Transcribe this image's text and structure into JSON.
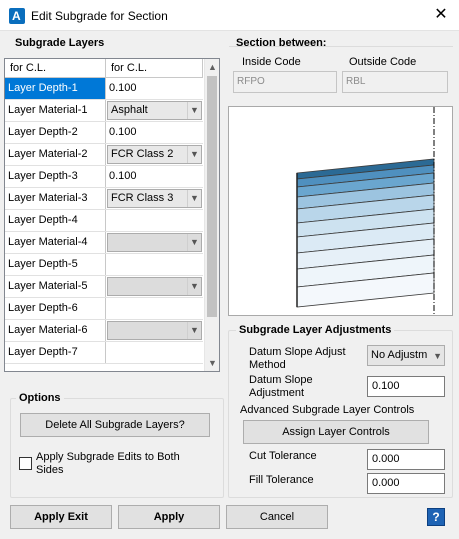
{
  "window": {
    "title": "Edit Subgrade for Section",
    "app_icon_letter": "A"
  },
  "subgrade_layers": {
    "group_label": "Subgrade Layers",
    "columns": [
      "for C.L.",
      "for C.L."
    ],
    "rows": [
      {
        "label": "Layer Depth-1",
        "type": "text",
        "value": "0.100",
        "selected": true
      },
      {
        "label": "Layer Material-1",
        "type": "combo",
        "value": "Asphalt"
      },
      {
        "label": "Layer Depth-2",
        "type": "text",
        "value": "0.100"
      },
      {
        "label": "Layer Material-2",
        "type": "combo",
        "value": "FCR Class 2"
      },
      {
        "label": "Layer Depth-3",
        "type": "text",
        "value": "0.100"
      },
      {
        "label": "Layer Material-3",
        "type": "combo",
        "value": "FCR Class 3"
      },
      {
        "label": "Layer Depth-4",
        "type": "text",
        "value": ""
      },
      {
        "label": "Layer Material-4",
        "type": "combo",
        "value": ""
      },
      {
        "label": "Layer Depth-5",
        "type": "text",
        "value": ""
      },
      {
        "label": "Layer Material-5",
        "type": "combo",
        "value": ""
      },
      {
        "label": "Layer Depth-6",
        "type": "text",
        "value": ""
      },
      {
        "label": "Layer Material-6",
        "type": "combo",
        "value": ""
      },
      {
        "label": "Layer Depth-7",
        "type": "text",
        "value": ""
      }
    ]
  },
  "section_between": {
    "group_label": "Section between:",
    "inside_label": "Inside Code",
    "inside_value": "RFPO",
    "outside_label": "Outside Code",
    "outside_value": "RBL"
  },
  "preview": {
    "layer_colors": [
      "#2b6a95",
      "#4f90bf",
      "#6aa6cf",
      "#9cc4e0",
      "#b9d6ea",
      "#cde2f0",
      "#dbeaf5",
      "#e6f0f8",
      "#eef5fa",
      "#f4f8fc"
    ]
  },
  "adjustments": {
    "group_label": "Subgrade Layer Adjustments",
    "datum_method_label": "Datum Slope Adjust Method",
    "datum_method_value": "No Adjustm",
    "datum_adjust_label": "Datum Slope Adjustment",
    "datum_adjust_value": "0.100",
    "advanced_label": "Advanced Subgrade Layer Controls",
    "assign_button": "Assign Layer Controls",
    "cut_label": "Cut Tolerance",
    "cut_value": "0.000",
    "fill_label": "Fill Tolerance",
    "fill_value": "0.000"
  },
  "options": {
    "group_label": "Options",
    "delete_button": "Delete All Subgrade Layers?",
    "apply_both_label": "Apply Subgrade Edits to Both Sides",
    "apply_both_checked": false
  },
  "footer": {
    "apply_exit": "Apply  Exit",
    "apply": "Apply",
    "cancel": "Cancel",
    "help": "?"
  }
}
